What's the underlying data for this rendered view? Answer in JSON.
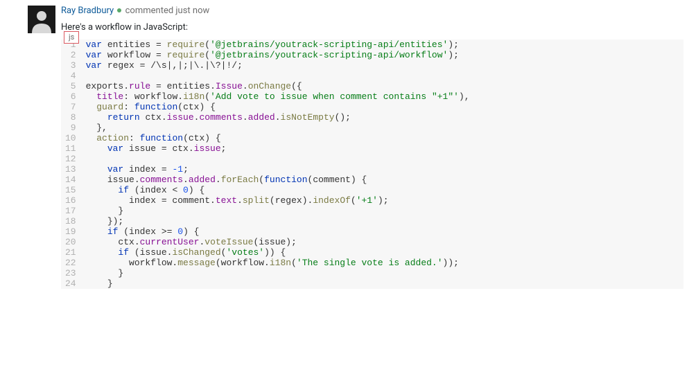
{
  "comment": {
    "author": "Ray Bradbury",
    "meta": "commented just now",
    "body": "Here's a workflow in JavaScript:"
  },
  "code": {
    "lang_badge": "js",
    "lines": [
      [
        {
          "t": "kw",
          "v": "var"
        },
        {
          "t": "op",
          "v": " entities = "
        },
        {
          "t": "fn",
          "v": "require"
        },
        {
          "t": "op",
          "v": "("
        },
        {
          "t": "str",
          "v": "'@jetbrains/youtrack-scripting-api/entities'"
        },
        {
          "t": "op",
          "v": ");"
        }
      ],
      [
        {
          "t": "kw",
          "v": "var"
        },
        {
          "t": "op",
          "v": " workflow = "
        },
        {
          "t": "fn",
          "v": "require"
        },
        {
          "t": "op",
          "v": "("
        },
        {
          "t": "str",
          "v": "'@jetbrains/youtrack-scripting-api/workflow'"
        },
        {
          "t": "op",
          "v": ");"
        }
      ],
      [
        {
          "t": "kw",
          "v": "var"
        },
        {
          "t": "op",
          "v": " regex = "
        },
        {
          "t": "regex",
          "v": "/\\s|,|;|\\.|\\?|!/"
        },
        {
          "t": "op",
          "v": ";"
        }
      ],
      [],
      [
        {
          "t": "op",
          "v": "exports."
        },
        {
          "t": "prop",
          "v": "rule"
        },
        {
          "t": "op",
          "v": " = entities."
        },
        {
          "t": "prop",
          "v": "Issue"
        },
        {
          "t": "op",
          "v": "."
        },
        {
          "t": "fn",
          "v": "onChange"
        },
        {
          "t": "op",
          "v": "({"
        }
      ],
      [
        {
          "t": "op",
          "v": "  "
        },
        {
          "t": "prop",
          "v": "title"
        },
        {
          "t": "op",
          "v": ": workflow."
        },
        {
          "t": "fn",
          "v": "i18n"
        },
        {
          "t": "op",
          "v": "("
        },
        {
          "t": "str",
          "v": "'Add vote to issue when comment contains \"+1\"'"
        },
        {
          "t": "op",
          "v": "),"
        }
      ],
      [
        {
          "t": "op",
          "v": "  "
        },
        {
          "t": "fn",
          "v": "guard"
        },
        {
          "t": "op",
          "v": ": "
        },
        {
          "t": "kw",
          "v": "function"
        },
        {
          "t": "op",
          "v": "(ctx) {"
        }
      ],
      [
        {
          "t": "op",
          "v": "    "
        },
        {
          "t": "kw",
          "v": "return"
        },
        {
          "t": "op",
          "v": " ctx."
        },
        {
          "t": "prop",
          "v": "issue"
        },
        {
          "t": "op",
          "v": "."
        },
        {
          "t": "prop",
          "v": "comments"
        },
        {
          "t": "op",
          "v": "."
        },
        {
          "t": "prop",
          "v": "added"
        },
        {
          "t": "op",
          "v": "."
        },
        {
          "t": "fn",
          "v": "isNotEmpty"
        },
        {
          "t": "op",
          "v": "();"
        }
      ],
      [
        {
          "t": "op",
          "v": "  },"
        }
      ],
      [
        {
          "t": "op",
          "v": "  "
        },
        {
          "t": "fn",
          "v": "action"
        },
        {
          "t": "op",
          "v": ": "
        },
        {
          "t": "kw",
          "v": "function"
        },
        {
          "t": "op",
          "v": "(ctx) {"
        }
      ],
      [
        {
          "t": "op",
          "v": "    "
        },
        {
          "t": "kw",
          "v": "var"
        },
        {
          "t": "op",
          "v": " issue = ctx."
        },
        {
          "t": "prop",
          "v": "issue"
        },
        {
          "t": "op",
          "v": ";"
        }
      ],
      [],
      [
        {
          "t": "op",
          "v": "    "
        },
        {
          "t": "kw",
          "v": "var"
        },
        {
          "t": "op",
          "v": " index = "
        },
        {
          "t": "num",
          "v": "-1"
        },
        {
          "t": "op",
          "v": ";"
        }
      ],
      [
        {
          "t": "op",
          "v": "    issue."
        },
        {
          "t": "prop",
          "v": "comments"
        },
        {
          "t": "op",
          "v": "."
        },
        {
          "t": "prop",
          "v": "added"
        },
        {
          "t": "op",
          "v": "."
        },
        {
          "t": "fn",
          "v": "forEach"
        },
        {
          "t": "op",
          "v": "("
        },
        {
          "t": "kw",
          "v": "function"
        },
        {
          "t": "op",
          "v": "(comment) {"
        }
      ],
      [
        {
          "t": "op",
          "v": "      "
        },
        {
          "t": "kw",
          "v": "if"
        },
        {
          "t": "op",
          "v": " (index < "
        },
        {
          "t": "num",
          "v": "0"
        },
        {
          "t": "op",
          "v": ") {"
        }
      ],
      [
        {
          "t": "op",
          "v": "        index = comment."
        },
        {
          "t": "prop",
          "v": "text"
        },
        {
          "t": "op",
          "v": "."
        },
        {
          "t": "fn",
          "v": "split"
        },
        {
          "t": "op",
          "v": "(regex)."
        },
        {
          "t": "fn",
          "v": "indexOf"
        },
        {
          "t": "op",
          "v": "("
        },
        {
          "t": "str",
          "v": "'+1'"
        },
        {
          "t": "op",
          "v": ");"
        }
      ],
      [
        {
          "t": "op",
          "v": "      }"
        }
      ],
      [
        {
          "t": "op",
          "v": "    });"
        }
      ],
      [
        {
          "t": "op",
          "v": "    "
        },
        {
          "t": "kw",
          "v": "if"
        },
        {
          "t": "op",
          "v": " (index >= "
        },
        {
          "t": "num",
          "v": "0"
        },
        {
          "t": "op",
          "v": ") {"
        }
      ],
      [
        {
          "t": "op",
          "v": "      ctx."
        },
        {
          "t": "prop",
          "v": "currentUser"
        },
        {
          "t": "op",
          "v": "."
        },
        {
          "t": "fn",
          "v": "voteIssue"
        },
        {
          "t": "op",
          "v": "(issue);"
        }
      ],
      [
        {
          "t": "op",
          "v": "      "
        },
        {
          "t": "kw",
          "v": "if"
        },
        {
          "t": "op",
          "v": " (issue."
        },
        {
          "t": "fn",
          "v": "isChanged"
        },
        {
          "t": "op",
          "v": "("
        },
        {
          "t": "str",
          "v": "'votes'"
        },
        {
          "t": "op",
          "v": ")) {"
        }
      ],
      [
        {
          "t": "op",
          "v": "        workflow."
        },
        {
          "t": "fn",
          "v": "message"
        },
        {
          "t": "op",
          "v": "(workflow."
        },
        {
          "t": "fn",
          "v": "i18n"
        },
        {
          "t": "op",
          "v": "("
        },
        {
          "t": "str",
          "v": "'The single vote is added.'"
        },
        {
          "t": "op",
          "v": "));"
        }
      ],
      [
        {
          "t": "op",
          "v": "      }"
        }
      ],
      [
        {
          "t": "op",
          "v": "    }"
        }
      ]
    ]
  }
}
